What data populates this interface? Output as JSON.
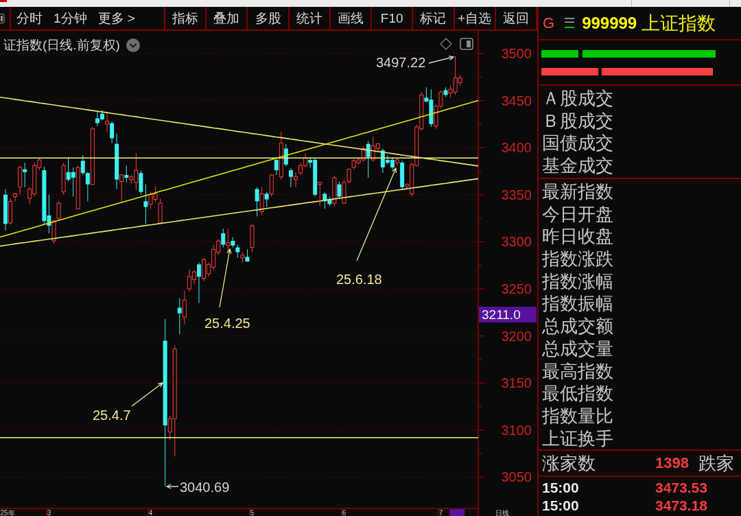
{
  "toolbar": {
    "views": [
      "分时",
      "1分钟",
      "更多 >"
    ],
    "buttons": [
      "指标",
      "叠加",
      "多股",
      "统计",
      "画线",
      "F10",
      "标记",
      "+自选",
      "返回"
    ]
  },
  "chart": {
    "price_tag": "3211.0",
    "period_label": "日线",
    "chart_data": [
      {
        "type": "candlestick",
        "title": "证指数(日线.前复权)",
        "categories": [
          "25年",
          null,
          null,
          null,
          null,
          null,
          null,
          null,
          null,
          "3",
          null,
          null,
          null,
          null,
          null,
          null,
          null,
          null,
          null,
          null,
          null,
          null,
          null,
          null,
          null,
          null,
          null,
          null,
          null,
          null,
          "4",
          null,
          null,
          null,
          null,
          null,
          null,
          null,
          null,
          null,
          null,
          null,
          null,
          null,
          null,
          null,
          null,
          null,
          null,
          null,
          null,
          "5",
          null,
          null,
          null,
          null,
          null,
          null,
          null,
          null,
          null,
          null,
          null,
          null,
          null,
          null,
          null,
          null,
          null,
          null,
          "6",
          null,
          null,
          null,
          null,
          null,
          null,
          null,
          null,
          null,
          null,
          null,
          null,
          null,
          null,
          null,
          null,
          null,
          null,
          null,
          "7",
          null,
          null,
          null,
          null
        ],
        "ohlc": [
          [
            3350,
            3356,
            3312,
            3319
          ],
          [
            3320,
            3346,
            3318,
            3343
          ],
          [
            3348,
            3352,
            3343,
            3351
          ],
          [
            3358,
            3381,
            3350,
            3379
          ],
          [
            3377,
            3384,
            3358,
            3374
          ],
          [
            3346,
            3358,
            3340,
            3356
          ],
          [
            3351,
            3384,
            3348,
            3381
          ],
          [
            3379,
            3389,
            3376,
            3387
          ],
          [
            3376,
            3380,
            3318,
            3322
          ],
          [
            3328,
            3350,
            3309,
            3317
          ],
          [
            3301,
            3324,
            3298,
            3322
          ],
          [
            3325,
            3343,
            3322,
            3341
          ],
          [
            3353,
            3384,
            3350,
            3381
          ],
          [
            3374,
            3390,
            3364,
            3366
          ],
          [
            3374,
            3379,
            3348,
            3368
          ],
          [
            3335,
            3381,
            3335,
            3379
          ],
          [
            3386,
            3392,
            3371,
            3373
          ],
          [
            3373,
            3374,
            3343,
            3361
          ],
          [
            3361,
            3422,
            3360,
            3420
          ],
          [
            3431,
            3438,
            3423,
            3426
          ],
          [
            3436,
            3440,
            3429,
            3430
          ],
          [
            3425,
            3438,
            3417,
            3428
          ],
          [
            3426,
            3428,
            3405,
            3410
          ],
          [
            3404,
            3415,
            3356,
            3366
          ],
          [
            3364,
            3372,
            3341,
            3371
          ],
          [
            3371,
            3381,
            3363,
            3368
          ],
          [
            3366,
            3371,
            3362,
            3369
          ],
          [
            3363,
            3394,
            3355,
            3376
          ],
          [
            3373,
            3376,
            3350,
            3353
          ],
          [
            3343,
            3361,
            3319,
            3337
          ],
          [
            3340,
            3353,
            3335,
            3350
          ],
          [
            3345,
            3359,
            3342,
            3351
          ],
          [
            3320,
            3346,
            3319,
            3341
          ],
          [
            3195,
            3218,
            3040.69,
            3105
          ],
          [
            3098,
            3115,
            3089,
            3112
          ],
          [
            3112,
            3190,
            3072,
            3186
          ],
          [
            3230,
            3240,
            3202,
            3224
          ],
          [
            3220,
            3248,
            3212,
            3238
          ],
          [
            3250,
            3271,
            3247,
            3263
          ],
          [
            3260,
            3270,
            3255,
            3268
          ],
          [
            3276,
            3278,
            3235,
            3263
          ],
          [
            3261,
            3283,
            3258,
            3281
          ],
          [
            3266,
            3278,
            3263,
            3276
          ],
          [
            3273,
            3297,
            3270,
            3292
          ],
          [
            3289,
            3303,
            3286,
            3301
          ],
          [
            3309,
            3314,
            3294,
            3297
          ],
          [
            3296,
            3314,
            3291,
            3299
          ],
          [
            3301,
            3305,
            3294,
            3296
          ],
          [
            3294,
            3297,
            3283,
            3289
          ],
          [
            3283,
            3289,
            3278,
            3286
          ],
          [
            3284,
            3292,
            3279,
            3279
          ],
          [
            3294,
            3319,
            3289,
            3317
          ],
          [
            3356,
            3358,
            3327,
            3343
          ],
          [
            3332,
            3358,
            3328,
            3351
          ],
          [
            3351,
            3353,
            3337,
            3345
          ],
          [
            3351,
            3372,
            3348,
            3371
          ],
          [
            3387,
            3390,
            3371,
            3376
          ],
          [
            3369,
            3417,
            3366,
            3405
          ],
          [
            3399,
            3404,
            3380,
            3382
          ],
          [
            3376,
            3378,
            3358,
            3369
          ],
          [
            3366,
            3374,
            3358,
            3369
          ],
          [
            3373,
            3384,
            3371,
            3381
          ],
          [
            3381,
            3394,
            3379,
            3389
          ],
          [
            3387,
            3390,
            3379,
            3384
          ],
          [
            3387,
            3389,
            3348,
            3350
          ],
          [
            3361,
            3364,
            3338,
            3363
          ],
          [
            3351,
            3353,
            3335,
            3343
          ],
          [
            3345,
            3348,
            3338,
            3340
          ],
          [
            3341,
            3370,
            3338,
            3368
          ],
          [
            3361,
            3364,
            3346,
            3348
          ],
          [
            3341,
            3366,
            3340,
            3363
          ],
          [
            3364,
            3378,
            3362,
            3377
          ],
          [
            3379,
            3388,
            3377,
            3386
          ],
          [
            3384,
            3390,
            3382,
            3387
          ],
          [
            3387,
            3401,
            3385,
            3399
          ],
          [
            3404,
            3407,
            3368,
            3390
          ],
          [
            3387,
            3412,
            3385,
            3402
          ],
          [
            3399,
            3405,
            3396,
            3404
          ],
          [
            3397,
            3399,
            3373,
            3379
          ],
          [
            3387,
            3392,
            3382,
            3384
          ],
          [
            3387,
            3390,
            3377,
            3379
          ],
          [
            3384,
            3389,
            3381,
            3387
          ],
          [
            3384,
            3386,
            3356,
            3358
          ],
          [
            3359,
            3362,
            3357,
            3361
          ],
          [
            3351,
            3384,
            3348,
            3382
          ],
          [
            3381,
            3424,
            3380,
            3422
          ],
          [
            3420,
            3459,
            3418,
            3456
          ],
          [
            3453,
            3464,
            3448,
            3449
          ],
          [
            3451,
            3462,
            3422,
            3425
          ],
          [
            3423,
            3446,
            3420,
            3444
          ],
          [
            3444,
            3461,
            3442,
            3459
          ],
          [
            3461,
            3464,
            3454,
            3456
          ],
          [
            3458,
            3466,
            3453,
            3462
          ],
          [
            3459,
            3497.22,
            3456,
            3474
          ],
          [
            3469,
            3477,
            3466,
            3474
          ]
        ],
        "series": [
          {
            "type": "line",
            "color": "#e8e870",
            "values": [
              3452.7,
              3452.0,
              3451.2,
              3450.5,
              3449.7,
              3449.0,
              3448.3,
              3447.5,
              3446.8,
              3446.0,
              3445.3,
              3444.6,
              3443.8,
              3443.1,
              3442.4,
              3441.6,
              3440.9,
              3440.1,
              3439.4,
              3438.7,
              3437.9,
              3437.2,
              3436.4,
              3435.7,
              3435.0,
              3434.2,
              3433.5,
              3432.8,
              3432.0,
              3431.3,
              3430.5,
              3429.8,
              3429.1,
              3428.3,
              3427.6,
              3426.8,
              3426.1,
              3425.4,
              3424.6,
              3423.9,
              3423.2,
              3422.4,
              3421.7,
              3420.9,
              3420.2,
              3419.5,
              3418.7,
              3418.0,
              3417.2,
              3416.5,
              3415.8,
              3415.0,
              3414.3,
              3413.6,
              3412.8,
              3412.1,
              3411.3,
              3410.6,
              3409.9,
              3409.1,
              3408.4,
              3407.6,
              3406.9,
              3406.2,
              3405.4,
              3404.7,
              3404.0,
              3403.2,
              3402.5,
              3401.7,
              3401.0,
              3400.3,
              3399.5,
              3398.8,
              3398.0,
              3397.3,
              3396.6,
              3395.8,
              3395.1,
              3394.4,
              3393.6,
              3392.9,
              3392.1,
              3391.4,
              3390.7,
              3389.9,
              3389.2,
              3388.4,
              3387.7,
              3387.0,
              3386.2,
              3385.5,
              3384.8,
              3384.0,
              3383.3
            ]
          },
          {
            "type": "line",
            "color": "#e6e600",
            "values": [
              3306.6,
              3308.1,
              3309.6,
              3311.0,
              3312.5,
              3314.0,
              3315.4,
              3316.9,
              3318.4,
              3319.8,
              3321.3,
              3322.8,
              3324.2,
              3325.7,
              3327.2,
              3328.6,
              3330.1,
              3331.6,
              3333.0,
              3334.5,
              3336.0,
              3337.4,
              3338.9,
              3340.4,
              3341.8,
              3343.3,
              3344.8,
              3346.2,
              3347.7,
              3349.2,
              3350.6,
              3352.1,
              3353.6,
              3355.0,
              3356.5,
              3358.0,
              3359.4,
              3360.9,
              3362.4,
              3363.8,
              3365.3,
              3366.8,
              3368.2,
              3369.7,
              3371.2,
              3372.6,
              3374.1,
              3375.6,
              3377.0,
              3378.5,
              3380.0,
              3381.4,
              3382.9,
              3384.4,
              3385.8,
              3387.3,
              3388.8,
              3390.2,
              3391.7,
              3393.2,
              3394.6,
              3396.1,
              3397.6,
              3399.0,
              3400.5,
              3402.0,
              3403.4,
              3404.9,
              3406.4,
              3407.8,
              3409.3,
              3410.8,
              3412.2,
              3413.7,
              3415.2,
              3416.6,
              3418.1,
              3419.6,
              3421.0,
              3422.5,
              3424.0,
              3425.4,
              3426.9,
              3428.4,
              3429.8,
              3431.3,
              3432.8,
              3434.2,
              3435.7,
              3437.2,
              3438.6,
              3440.1,
              3441.6,
              3443.0,
              3444.5
            ]
          },
          {
            "type": "line",
            "color": "#e8e870",
            "values": [
              3296.3,
              3297.0,
              3297.8,
              3298.5,
              3299.2,
              3299.9,
              3300.7,
              3301.4,
              3302.1,
              3302.8,
              3303.5,
              3304.3,
              3305.0,
              3305.7,
              3306.4,
              3307.2,
              3307.9,
              3308.6,
              3309.3,
              3310.1,
              3310.8,
              3311.5,
              3312.2,
              3313.0,
              3313.7,
              3314.4,
              3315.1,
              3315.8,
              3316.6,
              3317.3,
              3318.0,
              3318.7,
              3319.5,
              3320.2,
              3320.9,
              3321.6,
              3322.4,
              3323.1,
              3323.8,
              3324.5,
              3325.2,
              3326.0,
              3326.7,
              3327.4,
              3328.1,
              3328.9,
              3329.6,
              3330.3,
              3331.0,
              3331.8,
              3332.5,
              3333.2,
              3333.9,
              3334.6,
              3335.4,
              3336.1,
              3336.8,
              3337.5,
              3338.3,
              3339.0,
              3339.7,
              3340.4,
              3341.2,
              3341.9,
              3342.6,
              3343.3,
              3344.1,
              3344.8,
              3345.5,
              3346.2,
              3346.9,
              3347.7,
              3348.4,
              3349.1,
              3349.8,
              3350.6,
              3351.3,
              3352.0,
              3352.7,
              3353.5,
              3354.2,
              3354.9,
              3355.6,
              3356.3,
              3357.1,
              3357.8,
              3358.5,
              3359.2,
              3360.0,
              3360.7,
              3361.4,
              3362.1,
              3362.9,
              3363.6,
              3364.3
            ]
          }
        ],
        "ylim": [
          3016.8,
          3524
        ],
        "yticks": [
          3050,
          3100,
          3150,
          3200,
          3250,
          3300,
          3350,
          3400,
          3450,
          3500
        ],
        "grid": true,
        "ref_lines": [
          {
            "axis": "y",
            "value": 3389,
            "color": "#f2f27a"
          },
          {
            "axis": "y",
            "value": 3092,
            "color": "#f2f27a"
          }
        ],
        "annotations": [
          "3497.22",
          "3040.69",
          "25.4.7",
          "25.4.25",
          "25.6.18"
        ]
      }
    ]
  },
  "quote_panel": {
    "market": "G",
    "code": "999999",
    "name": "上证指数",
    "volume_labels": [
      "Ａ股成交",
      "Ｂ股成交",
      "国债成交",
      "基金成交"
    ],
    "index_labels": [
      "最新指数",
      "今日开盘",
      "昨日收盘",
      "指数涨跌",
      "指数涨幅",
      "指数振幅",
      "总成交额",
      "总成交量",
      "最高指数",
      "最低指数",
      "指数量比",
      "上证换手"
    ],
    "breadth": {
      "label": "涨家数",
      "value": "1398",
      "second_label": "跌家"
    },
    "ticks": [
      {
        "time": "15:00",
        "price": "3473.53"
      },
      {
        "time": "15:00",
        "price": "3473.18"
      }
    ]
  }
}
